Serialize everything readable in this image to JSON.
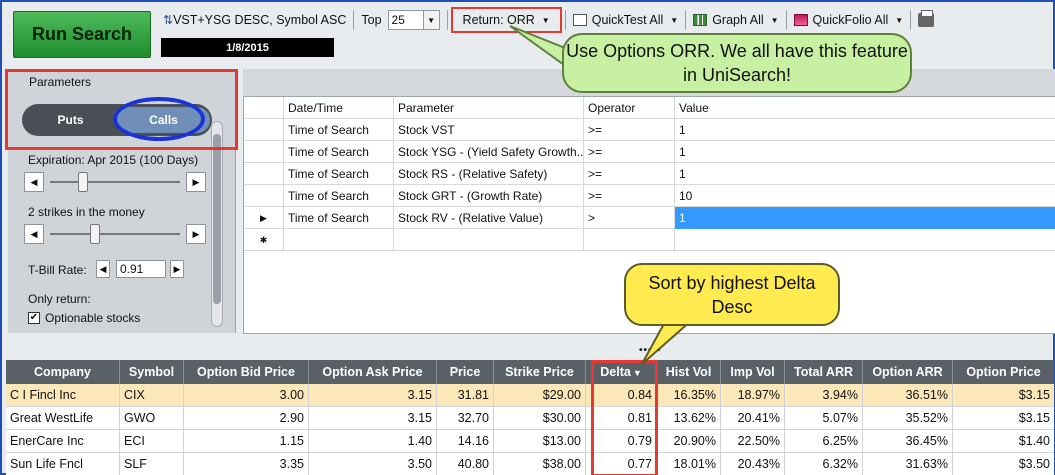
{
  "toolbar": {
    "run_label": "Run Search",
    "sort_label": "VST+YSG DESC, Symbol ASC",
    "top_label": "Top",
    "top_value": "25",
    "return_label": "Return: ORR",
    "quicktest_label": "QuickTest All",
    "graph_label": "Graph All",
    "quickfolio_label": "QuickFolio All",
    "date": "1/8/2015"
  },
  "callouts": {
    "orr": "Use Options ORR. We all have this feature in UniSearch!",
    "delta": "Sort by highest Delta Desc"
  },
  "params": {
    "title": "Parameters",
    "puts": "Puts",
    "calls": "Calls",
    "expiration": "Expiration:  Apr 2015  (100 Days)",
    "strikes": "2 strikes in the money",
    "tbill_label": "T-Bill Rate:",
    "tbill_value": "0.91",
    "only_return": "Only return:",
    "optionable": "Optionable stocks"
  },
  "pgrid": {
    "headers": [
      "Date/Time",
      "Parameter",
      "Operator",
      "Value"
    ],
    "rows": [
      [
        "Time of Search",
        "Stock VST",
        ">=",
        "1"
      ],
      [
        "Time of Search",
        "Stock YSG - (Yield Safety Growth...",
        ">=",
        "1"
      ],
      [
        "Time of Search",
        "Stock RS - (Relative Safety)",
        ">=",
        "1"
      ],
      [
        "Time of Search",
        "Stock GRT - (Growth Rate)",
        ">=",
        "10"
      ],
      [
        "Time of Search",
        "Stock RV - (Relative Value)",
        ">",
        "1"
      ]
    ]
  },
  "results": {
    "headers": [
      "Company",
      "Symbol",
      "Option Bid Price",
      "Option Ask Price",
      "Price",
      "Strike Price",
      "Delta",
      "Hist Vol",
      "Imp Vol",
      "Total ARR",
      "Option ARR",
      "Option Price"
    ],
    "rows": [
      [
        "C I Fincl Inc",
        "CIX",
        "3.00",
        "3.15",
        "31.81",
        "$29.00",
        "0.84",
        "16.35%",
        "18.97%",
        "3.94%",
        "36.51%",
        "$3.15"
      ],
      [
        "Great WestLife",
        "GWO",
        "2.90",
        "3.15",
        "32.70",
        "$30.00",
        "0.81",
        "13.62%",
        "20.41%",
        "5.07%",
        "35.52%",
        "$3.15"
      ],
      [
        "EnerCare Inc",
        "ECI",
        "1.15",
        "1.40",
        "14.16",
        "$13.00",
        "0.79",
        "20.90%",
        "22.50%",
        "6.25%",
        "36.45%",
        "$1.40"
      ],
      [
        "Sun Life Fncl",
        "SLF",
        "3.35",
        "3.50",
        "40.80",
        "$38.00",
        "0.77",
        "18.01%",
        "20.43%",
        "6.32%",
        "31.63%",
        "$3.50"
      ]
    ]
  }
}
